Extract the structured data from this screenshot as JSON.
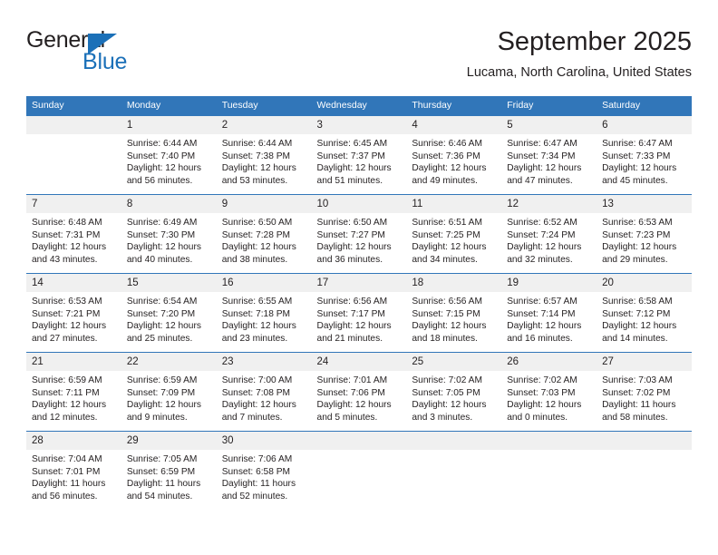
{
  "logo": {
    "word1": "General",
    "word2": "Blue",
    "triangle_color": "#1b70b8",
    "icon": "triangle-icon"
  },
  "header": {
    "title": "September 2025",
    "subtitle": "Lucama, North Carolina, United States"
  },
  "colors": {
    "header_bg": "#3176b9",
    "daynum_bg": "#f0f0f0",
    "text": "#231f20",
    "accent": "#1b70b8"
  },
  "calendar": {
    "weekday_headers": [
      "Sunday",
      "Monday",
      "Tuesday",
      "Wednesday",
      "Thursday",
      "Friday",
      "Saturday"
    ],
    "weeks": [
      [
        {
          "day": "",
          "empty": true,
          "sunrise": "",
          "sunset": "",
          "daylight1": "",
          "daylight2": ""
        },
        {
          "day": "1",
          "empty": false,
          "sunrise": "Sunrise: 6:44 AM",
          "sunset": "Sunset: 7:40 PM",
          "daylight1": "Daylight: 12 hours",
          "daylight2": "and 56 minutes."
        },
        {
          "day": "2",
          "empty": false,
          "sunrise": "Sunrise: 6:44 AM",
          "sunset": "Sunset: 7:38 PM",
          "daylight1": "Daylight: 12 hours",
          "daylight2": "and 53 minutes."
        },
        {
          "day": "3",
          "empty": false,
          "sunrise": "Sunrise: 6:45 AM",
          "sunset": "Sunset: 7:37 PM",
          "daylight1": "Daylight: 12 hours",
          "daylight2": "and 51 minutes."
        },
        {
          "day": "4",
          "empty": false,
          "sunrise": "Sunrise: 6:46 AM",
          "sunset": "Sunset: 7:36 PM",
          "daylight1": "Daylight: 12 hours",
          "daylight2": "and 49 minutes."
        },
        {
          "day": "5",
          "empty": false,
          "sunrise": "Sunrise: 6:47 AM",
          "sunset": "Sunset: 7:34 PM",
          "daylight1": "Daylight: 12 hours",
          "daylight2": "and 47 minutes."
        },
        {
          "day": "6",
          "empty": false,
          "sunrise": "Sunrise: 6:47 AM",
          "sunset": "Sunset: 7:33 PM",
          "daylight1": "Daylight: 12 hours",
          "daylight2": "and 45 minutes."
        }
      ],
      [
        {
          "day": "7",
          "empty": false,
          "sunrise": "Sunrise: 6:48 AM",
          "sunset": "Sunset: 7:31 PM",
          "daylight1": "Daylight: 12 hours",
          "daylight2": "and 43 minutes."
        },
        {
          "day": "8",
          "empty": false,
          "sunrise": "Sunrise: 6:49 AM",
          "sunset": "Sunset: 7:30 PM",
          "daylight1": "Daylight: 12 hours",
          "daylight2": "and 40 minutes."
        },
        {
          "day": "9",
          "empty": false,
          "sunrise": "Sunrise: 6:50 AM",
          "sunset": "Sunset: 7:28 PM",
          "daylight1": "Daylight: 12 hours",
          "daylight2": "and 38 minutes."
        },
        {
          "day": "10",
          "empty": false,
          "sunrise": "Sunrise: 6:50 AM",
          "sunset": "Sunset: 7:27 PM",
          "daylight1": "Daylight: 12 hours",
          "daylight2": "and 36 minutes."
        },
        {
          "day": "11",
          "empty": false,
          "sunrise": "Sunrise: 6:51 AM",
          "sunset": "Sunset: 7:25 PM",
          "daylight1": "Daylight: 12 hours",
          "daylight2": "and 34 minutes."
        },
        {
          "day": "12",
          "empty": false,
          "sunrise": "Sunrise: 6:52 AM",
          "sunset": "Sunset: 7:24 PM",
          "daylight1": "Daylight: 12 hours",
          "daylight2": "and 32 minutes."
        },
        {
          "day": "13",
          "empty": false,
          "sunrise": "Sunrise: 6:53 AM",
          "sunset": "Sunset: 7:23 PM",
          "daylight1": "Daylight: 12 hours",
          "daylight2": "and 29 minutes."
        }
      ],
      [
        {
          "day": "14",
          "empty": false,
          "sunrise": "Sunrise: 6:53 AM",
          "sunset": "Sunset: 7:21 PM",
          "daylight1": "Daylight: 12 hours",
          "daylight2": "and 27 minutes."
        },
        {
          "day": "15",
          "empty": false,
          "sunrise": "Sunrise: 6:54 AM",
          "sunset": "Sunset: 7:20 PM",
          "daylight1": "Daylight: 12 hours",
          "daylight2": "and 25 minutes."
        },
        {
          "day": "16",
          "empty": false,
          "sunrise": "Sunrise: 6:55 AM",
          "sunset": "Sunset: 7:18 PM",
          "daylight1": "Daylight: 12 hours",
          "daylight2": "and 23 minutes."
        },
        {
          "day": "17",
          "empty": false,
          "sunrise": "Sunrise: 6:56 AM",
          "sunset": "Sunset: 7:17 PM",
          "daylight1": "Daylight: 12 hours",
          "daylight2": "and 21 minutes."
        },
        {
          "day": "18",
          "empty": false,
          "sunrise": "Sunrise: 6:56 AM",
          "sunset": "Sunset: 7:15 PM",
          "daylight1": "Daylight: 12 hours",
          "daylight2": "and 18 minutes."
        },
        {
          "day": "19",
          "empty": false,
          "sunrise": "Sunrise: 6:57 AM",
          "sunset": "Sunset: 7:14 PM",
          "daylight1": "Daylight: 12 hours",
          "daylight2": "and 16 minutes."
        },
        {
          "day": "20",
          "empty": false,
          "sunrise": "Sunrise: 6:58 AM",
          "sunset": "Sunset: 7:12 PM",
          "daylight1": "Daylight: 12 hours",
          "daylight2": "and 14 minutes."
        }
      ],
      [
        {
          "day": "21",
          "empty": false,
          "sunrise": "Sunrise: 6:59 AM",
          "sunset": "Sunset: 7:11 PM",
          "daylight1": "Daylight: 12 hours",
          "daylight2": "and 12 minutes."
        },
        {
          "day": "22",
          "empty": false,
          "sunrise": "Sunrise: 6:59 AM",
          "sunset": "Sunset: 7:09 PM",
          "daylight1": "Daylight: 12 hours",
          "daylight2": "and 9 minutes."
        },
        {
          "day": "23",
          "empty": false,
          "sunrise": "Sunrise: 7:00 AM",
          "sunset": "Sunset: 7:08 PM",
          "daylight1": "Daylight: 12 hours",
          "daylight2": "and 7 minutes."
        },
        {
          "day": "24",
          "empty": false,
          "sunrise": "Sunrise: 7:01 AM",
          "sunset": "Sunset: 7:06 PM",
          "daylight1": "Daylight: 12 hours",
          "daylight2": "and 5 minutes."
        },
        {
          "day": "25",
          "empty": false,
          "sunrise": "Sunrise: 7:02 AM",
          "sunset": "Sunset: 7:05 PM",
          "daylight1": "Daylight: 12 hours",
          "daylight2": "and 3 minutes."
        },
        {
          "day": "26",
          "empty": false,
          "sunrise": "Sunrise: 7:02 AM",
          "sunset": "Sunset: 7:03 PM",
          "daylight1": "Daylight: 12 hours",
          "daylight2": "and 0 minutes."
        },
        {
          "day": "27",
          "empty": false,
          "sunrise": "Sunrise: 7:03 AM",
          "sunset": "Sunset: 7:02 PM",
          "daylight1": "Daylight: 11 hours",
          "daylight2": "and 58 minutes."
        }
      ],
      [
        {
          "day": "28",
          "empty": false,
          "sunrise": "Sunrise: 7:04 AM",
          "sunset": "Sunset: 7:01 PM",
          "daylight1": "Daylight: 11 hours",
          "daylight2": "and 56 minutes."
        },
        {
          "day": "29",
          "empty": false,
          "sunrise": "Sunrise: 7:05 AM",
          "sunset": "Sunset: 6:59 PM",
          "daylight1": "Daylight: 11 hours",
          "daylight2": "and 54 minutes."
        },
        {
          "day": "30",
          "empty": false,
          "sunrise": "Sunrise: 7:06 AM",
          "sunset": "Sunset: 6:58 PM",
          "daylight1": "Daylight: 11 hours",
          "daylight2": "and 52 minutes."
        },
        {
          "day": "",
          "empty": true,
          "sunrise": "",
          "sunset": "",
          "daylight1": "",
          "daylight2": ""
        },
        {
          "day": "",
          "empty": true,
          "sunrise": "",
          "sunset": "",
          "daylight1": "",
          "daylight2": ""
        },
        {
          "day": "",
          "empty": true,
          "sunrise": "",
          "sunset": "",
          "daylight1": "",
          "daylight2": ""
        },
        {
          "day": "",
          "empty": true,
          "sunrise": "",
          "sunset": "",
          "daylight1": "",
          "daylight2": ""
        }
      ]
    ]
  }
}
